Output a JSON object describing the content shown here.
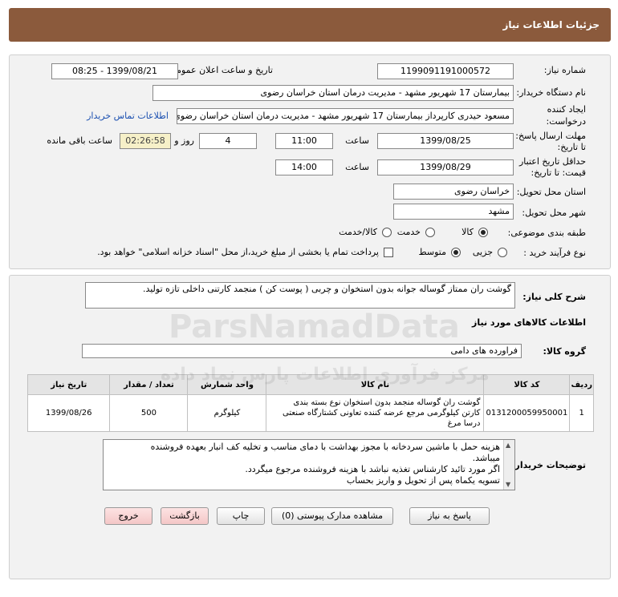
{
  "header": {
    "title": "جزئیات اطلاعات نیاز"
  },
  "fields": {
    "need_number_label": "شماره نیاز:",
    "need_number": "1199091191000572",
    "announce_label": "تاریخ و ساعت اعلان عمومی:",
    "announce_value": "1399/08/21 - 08:25",
    "buyer_org_label": "نام دستگاه خریدار:",
    "buyer_org": "بیمارستان 17 شهریور مشهد - مدیریت درمان استان خراسان رضوی",
    "creator_label_1": "ایجاد کننده",
    "creator_label_2": "درخواست:",
    "creator": "مسعود حیدری کارپرداز بیمارستان 17 شهریور مشهد - مدیریت درمان استان خراسان رضوی",
    "contact_link": "اطلاعات تماس خریدار",
    "deadline_label_1": "مهلت ارسال پاسخ:",
    "deadline_label_2": "تا تاریخ:",
    "deadline_date": "1399/08/25",
    "time_label": "ساعت",
    "deadline_time": "11:00",
    "days_value": "4",
    "days_label": "روز و",
    "remaining_time": "02:26:58",
    "remaining_label": "ساعت باقی مانده",
    "validity_label_1": "حداقل تاریخ اعتبار",
    "validity_label_2": "قیمت: تا تاریخ:",
    "validity_date": "1399/08/29",
    "validity_time": "14:00",
    "province_label": "استان محل تحویل:",
    "province": "خراسان رضوی",
    "city_label": "شهر محل تحویل:",
    "city": "مشهد",
    "category_label": "طبقه بندی موضوعی:",
    "category_options": [
      "کالا",
      "خدمت",
      "کالا/خدمت"
    ],
    "category_selected": "کالا",
    "process_label": "نوع فرآیند خرید :",
    "process_options": [
      "جزیی",
      "متوسط"
    ],
    "process_selected": "متوسط",
    "payment_note": "پرداخت تمام یا بخشی از مبلغ خرید،از محل \"اسناد خزانه اسلامی\" خواهد بود."
  },
  "description": {
    "label": "شرح کلی نیاز:",
    "text": "گوشت ران ممتاز گوساله جوانه بدون استخوان و چربی ( پوست کن ) منجمد کارتنی داخلی تازه تولید."
  },
  "goods": {
    "section_title": "اطلاعات کالاهای مورد نیاز",
    "group_label": "گروه کالا:",
    "group_value": "فراورده های دامی",
    "columns": [
      "ردیف",
      "کد کالا",
      "نام کالا",
      "واحد شمارش",
      "تعداد / مقدار",
      "تاریخ نیاز"
    ],
    "rows": [
      {
        "row": "1",
        "code": "0131200059950001",
        "name_lines": [
          "گوشت ران گوساله منجمد بدون استخوان نوع بسته بندی",
          "کارتن کیلوگرمی مرجع عرضه کننده تعاونی کشتارگاه صنعتی",
          "درسا مرغ"
        ],
        "unit": "کیلوگرم",
        "qty": "500",
        "date": "1399/08/26"
      }
    ]
  },
  "buyer_notes": {
    "label": "توضیحات خریدار:",
    "lines": [
      "هزینه حمل با ماشین سردخانه با مجوز بهداشت با دمای مناسب و تخلیه کف انبار بعهده فروشنده",
      "میباشد.",
      "اگر مورد تائید کارشناس تغذیه نباشد با هزینه فروشنده مرجوع میگردد.",
      "تسویه یکماه پس از تحویل و واریز بحساب"
    ]
  },
  "buttons": {
    "reply": "پاسخ به نیاز",
    "attachments": "مشاهده مدارک پیوستی (0)",
    "print": "چاپ",
    "back": "بازگشت",
    "exit": "خروج"
  },
  "watermark": {
    "brand": "ParsNamadData",
    "tagline": "مرکز فرآوری اطلاعات پارس نماد داده"
  }
}
